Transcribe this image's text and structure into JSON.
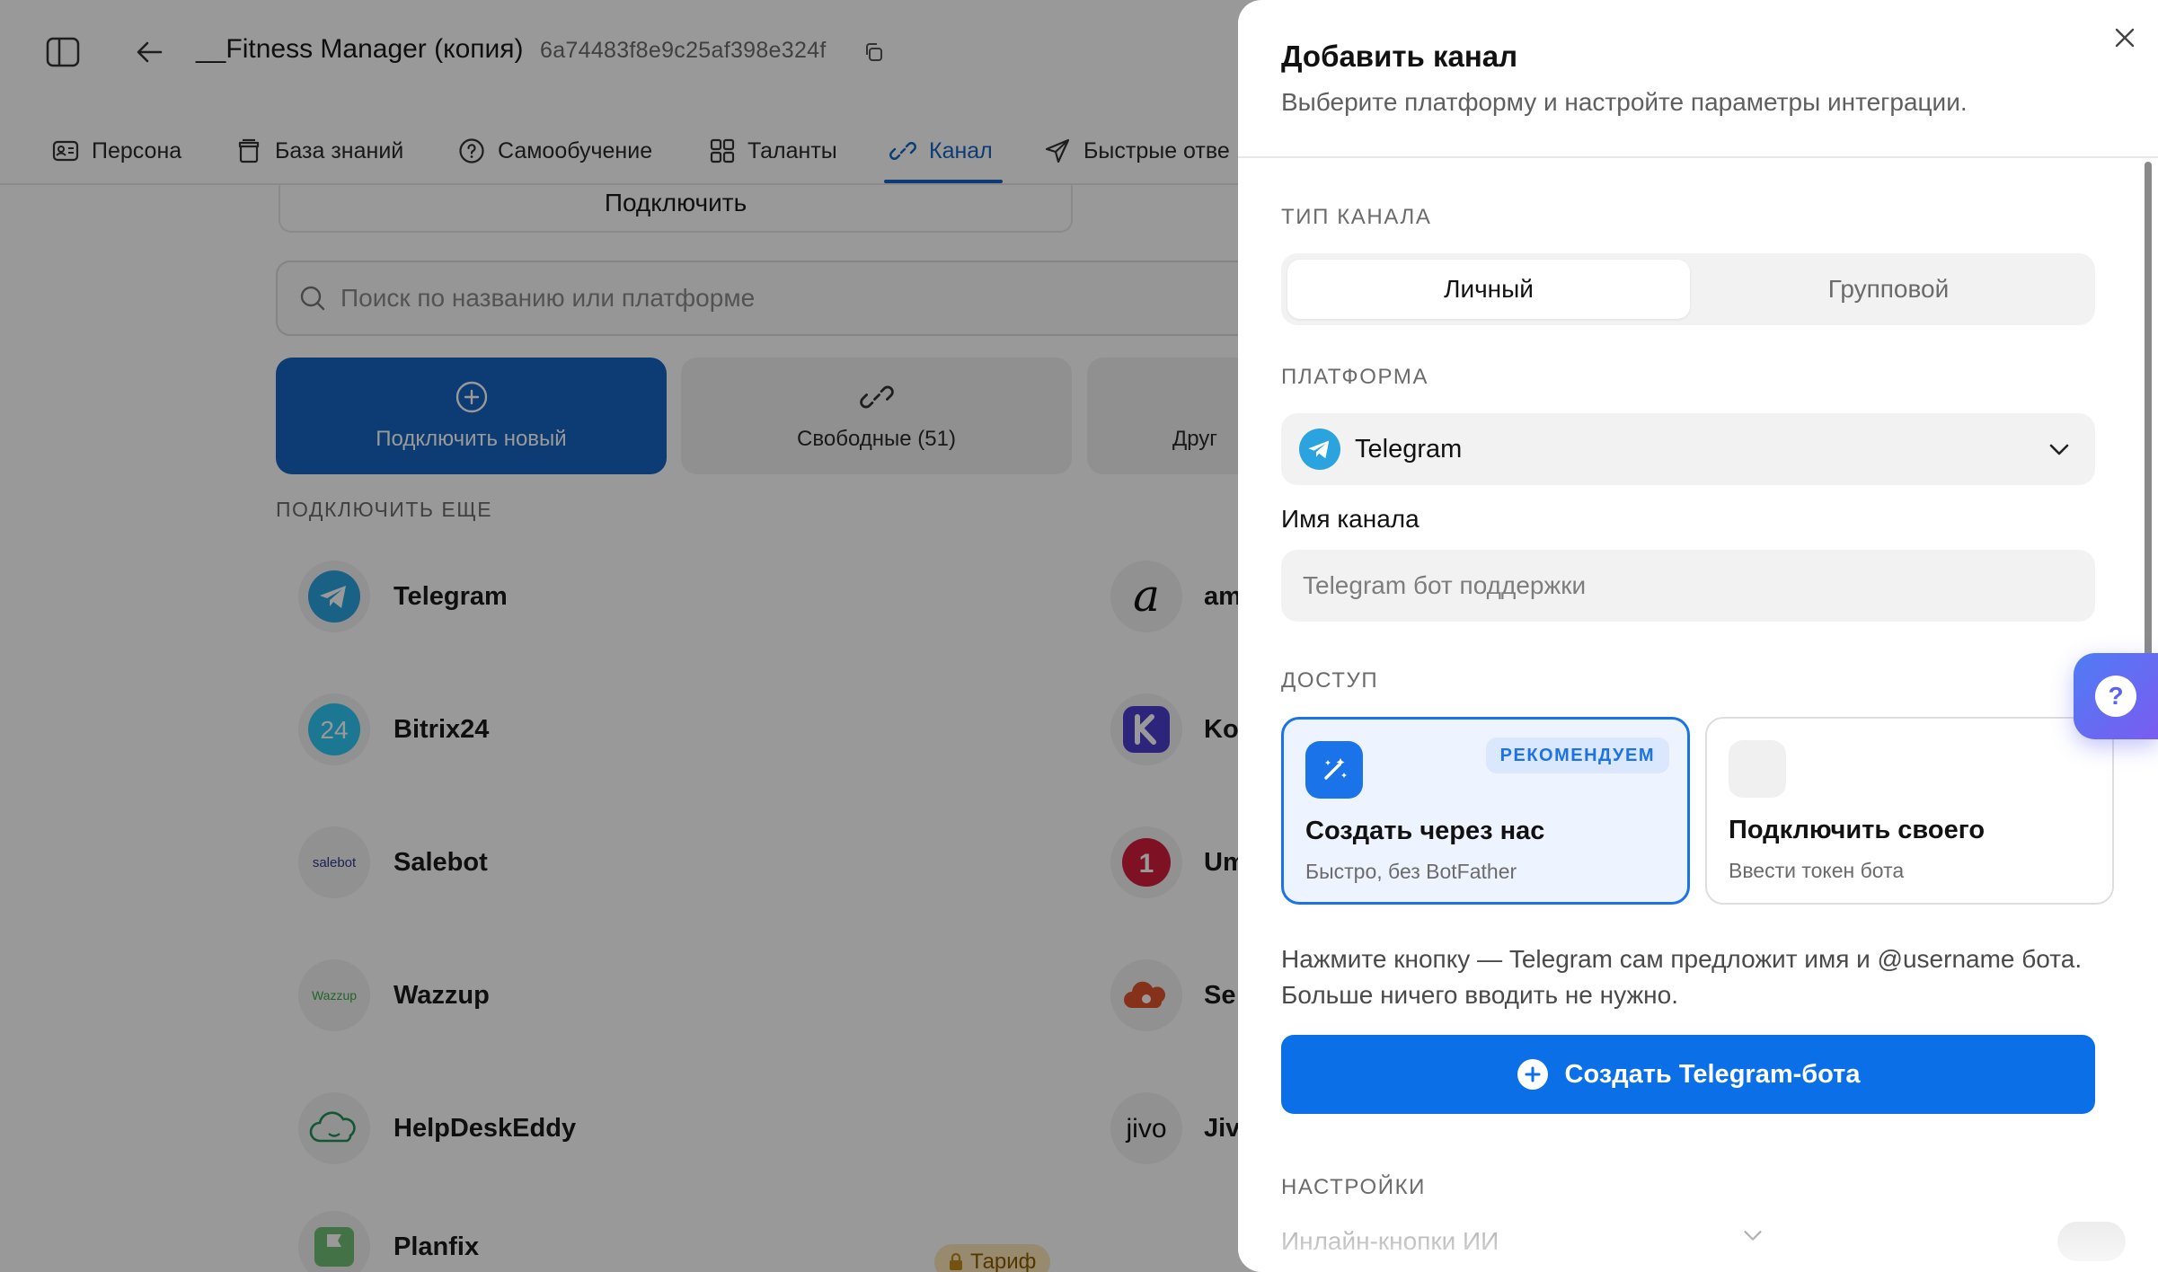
{
  "app": {
    "title": "__Fitness Manager (копия)",
    "id": "6a74483f8e9c25af398e324f",
    "tabs": [
      {
        "label": "Персона",
        "icon": "id-card-icon"
      },
      {
        "label": "База знаний",
        "icon": "archive-icon"
      },
      {
        "label": "Самообучение",
        "icon": "help-circle-icon"
      },
      {
        "label": "Таланты",
        "icon": "grid-icon"
      },
      {
        "label": "Канал",
        "icon": "link-icon",
        "active": true
      },
      {
        "label": "Быстрые отве",
        "icon": "send-icon"
      }
    ],
    "connect_top_label": "Подключить",
    "search_placeholder": "Поиск по названию или платформе",
    "modes": [
      {
        "label": "Подключить новый",
        "icon": "plus-circle-icon"
      },
      {
        "label": "Свободные (51)",
        "icon": "link-icon"
      },
      {
        "label": "Друг",
        "icon": ""
      }
    ],
    "more_heading": "ПОДКЛЮЧИТЬ ЕЩЕ",
    "services_left": [
      "Telegram",
      "Bitrix24",
      "Salebot",
      "Wazzup",
      "HelpDeskEddy",
      "Planfix"
    ],
    "services_right": [
      "am",
      "Ko",
      "Um",
      "Se",
      "Jiv"
    ],
    "tarif_badge": "Тариф",
    "accent": "#1565c0"
  },
  "panel": {
    "title": "Добавить канал",
    "subtitle": "Выберите платформу и настройте параметры интеграции.",
    "channel_type_label": "ТИП КАНАЛА",
    "channel_types": [
      "Личный",
      "Групповой"
    ],
    "selected_channel_type": "Личный",
    "platform_label": "ПЛАТФОРМА",
    "platform_value": "Telegram",
    "name_label": "Имя канала",
    "name_placeholder": "Telegram бот поддержки",
    "access_label": "ДОСТУП",
    "access_options": [
      {
        "title": "Создать через нас",
        "desc": "Быстро, без BotFather",
        "badge": "РЕКОМЕНДУЕМ",
        "selected": true
      },
      {
        "title": "Подключить своего",
        "desc": "Ввести токен бота"
      }
    ],
    "hint": "Нажмите кнопку — Telegram сам предложит имя и @username бота. Больше ничего вводить не нужно.",
    "create_button": "Создать Telegram-бота",
    "settings_label": "НАСТРОЙКИ",
    "inline_buttons_label": "Инлайн-кнопки ИИ",
    "primary_color": "#0b6fe8",
    "telegram_color": "#2aa3df"
  },
  "help_label": "?"
}
